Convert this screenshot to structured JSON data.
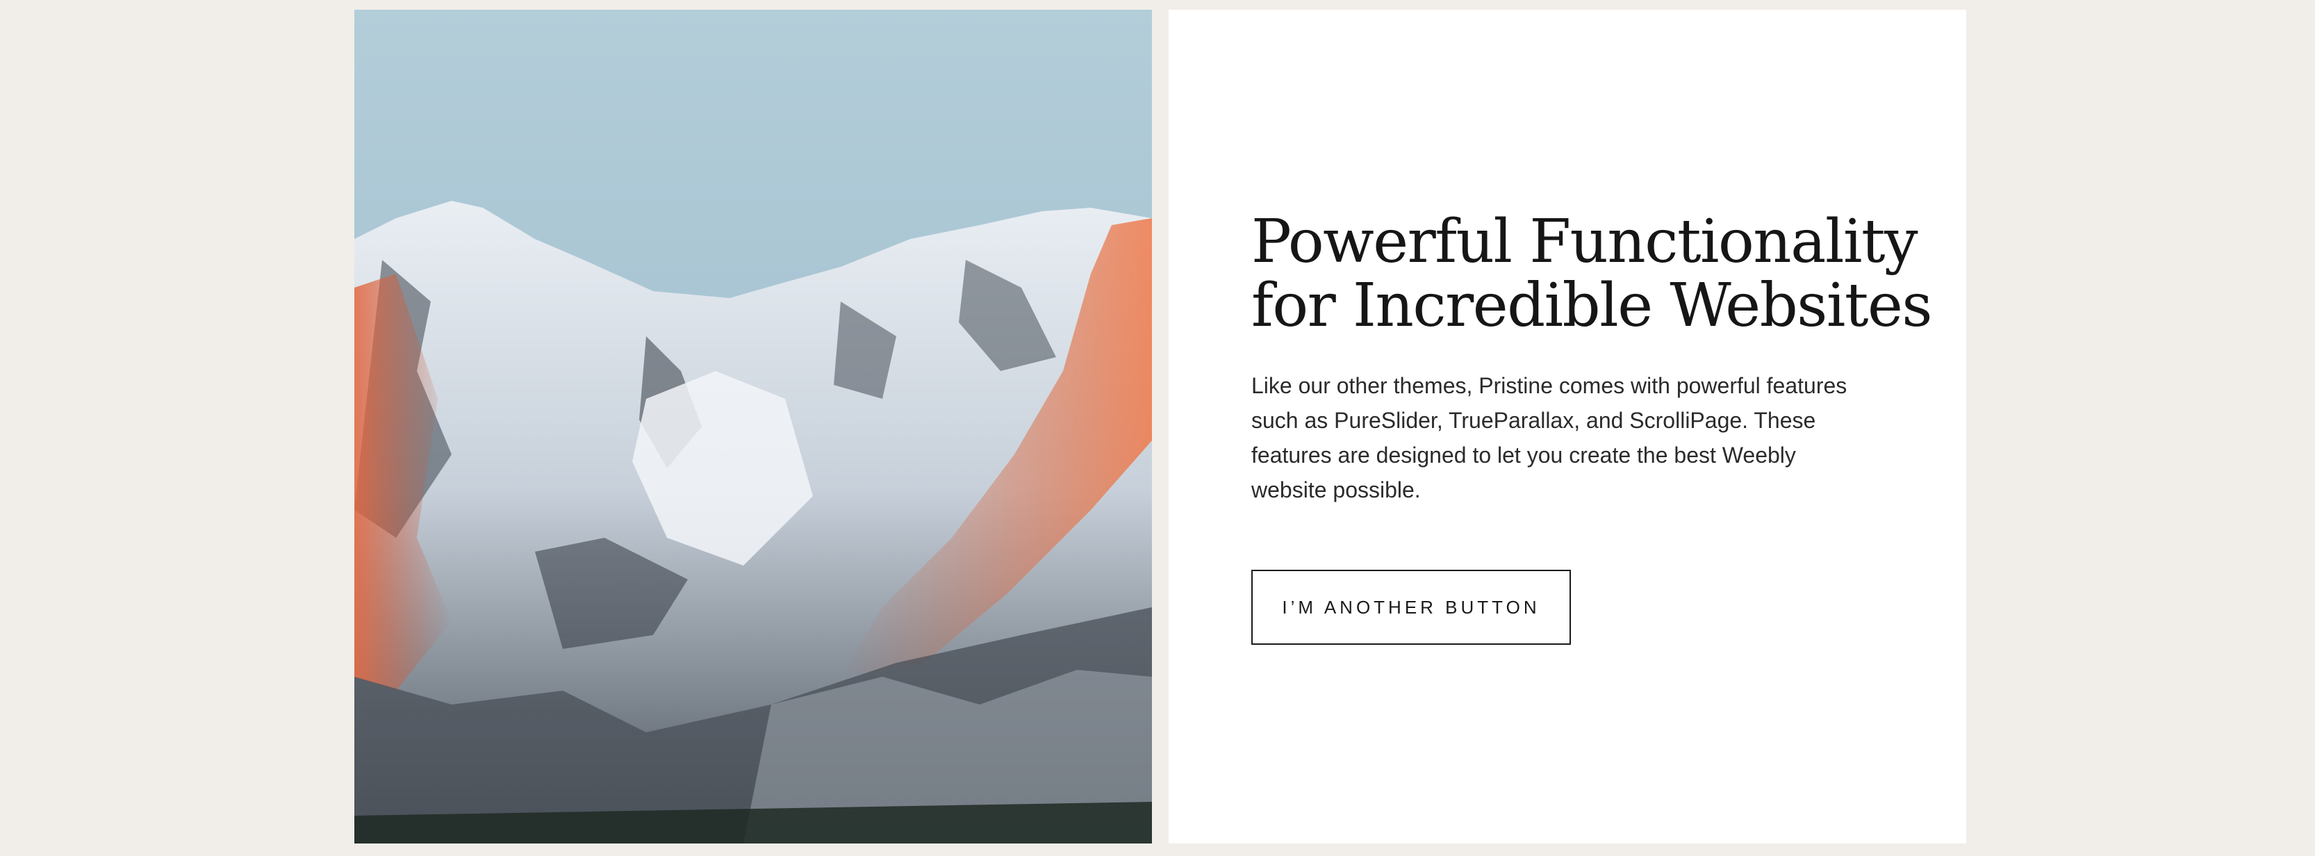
{
  "feature_section": {
    "headline_line1": "Powerful Functionality",
    "headline_line2": "for Incredible Websites",
    "body": "Like our other themes, Pristine comes with powerful features such as PureSlider, TrueParallax, and ScrolliPage. These features are designed to let you create the best Weebly website possible.",
    "button_label": "I’M ANOTHER BUTTON"
  },
  "colors": {
    "page_background": "#f1eee9",
    "panel_background": "#ffffff",
    "text_primary": "#161616",
    "button_border": "#1a1a1a"
  }
}
